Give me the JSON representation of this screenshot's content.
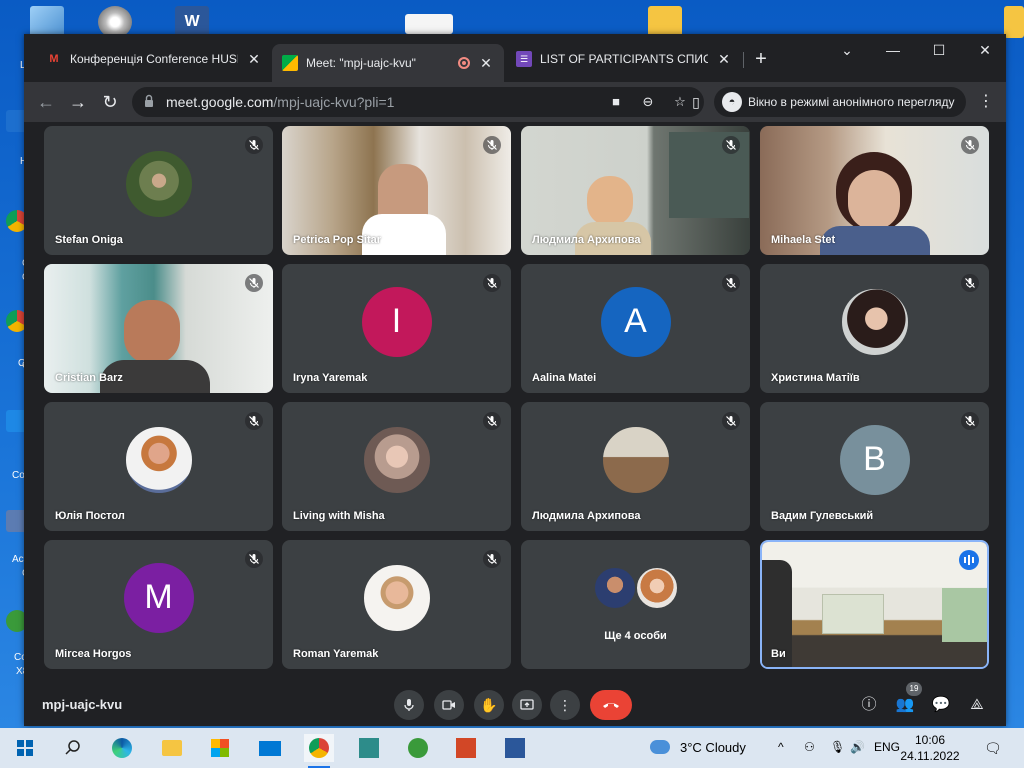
{
  "desktop": {
    "left_icon_captions": [
      "L",
      "H",
      "C",
      "C",
      "O",
      "C",
      "Co",
      "Acr",
      "C",
      "Co",
      "X8"
    ]
  },
  "browser": {
    "tabs": [
      {
        "label": "Конференція Conference HUSKI",
        "icon": "gmail-icon",
        "active": false
      },
      {
        "label": "Meet: \"mpj-uajc-kvu\"",
        "icon": "meet-icon",
        "active": true,
        "recording": true
      },
      {
        "label": "LIST OF PARTICIPANTS СПИСОК",
        "icon": "forms-icon",
        "active": false
      }
    ],
    "url_host": "meet.google.com",
    "url_path": "/mpj-uajc-kvu?pli=1",
    "incognito_label": "Вікно в режимі анонімного перегляду"
  },
  "meet": {
    "code": "mpj-uajc-kvu",
    "participant_count": "19",
    "tiles": [
      {
        "name": "Stefan Oniga",
        "kind": "photo",
        "color": "#7a8a55"
      },
      {
        "name": "Petrica Pop Sitar",
        "kind": "video"
      },
      {
        "name": "Людмила Архипова",
        "kind": "video"
      },
      {
        "name": "Mihaela Stet",
        "kind": "video"
      },
      {
        "name": "Cristian Barz",
        "kind": "video"
      },
      {
        "name": "Iryna Yaremak",
        "kind": "letter",
        "letter": "I",
        "color": "#c2185b"
      },
      {
        "name": "Aalina Matei",
        "kind": "letter",
        "letter": "A",
        "color": "#1565c0"
      },
      {
        "name": "Христина Матіїв",
        "kind": "photo",
        "color": "#5b4a44"
      },
      {
        "name": "Юлія Постол",
        "kind": "photo",
        "color": "#d8c9c2"
      },
      {
        "name": "Living with Misha",
        "kind": "photo",
        "color": "#8a6f6a"
      },
      {
        "name": "Людмила Архипова",
        "kind": "photo",
        "color": "#a49a86"
      },
      {
        "name": "Вадим Гулевський",
        "kind": "letter",
        "letter": "B",
        "color": "#78909c"
      },
      {
        "name": "Mircea Horgos",
        "kind": "letter",
        "letter": "M",
        "color": "#7b1fa2"
      },
      {
        "name": "Roman Yaremak",
        "kind": "photo",
        "color": "#e9e4df"
      },
      {
        "name": "Ще 4 особи",
        "kind": "more"
      },
      {
        "name": "Ви",
        "kind": "video-self"
      }
    ]
  },
  "taskbar": {
    "weather": "3°C  Cloudy",
    "lang": "ENG",
    "time": "10:06",
    "date": "24.11.2022"
  },
  "colors": {
    "meet_bg": "#202124",
    "tile_bg": "#3c4043",
    "end_call": "#ea4335",
    "active_speaker_border": "#8ab4f8"
  }
}
